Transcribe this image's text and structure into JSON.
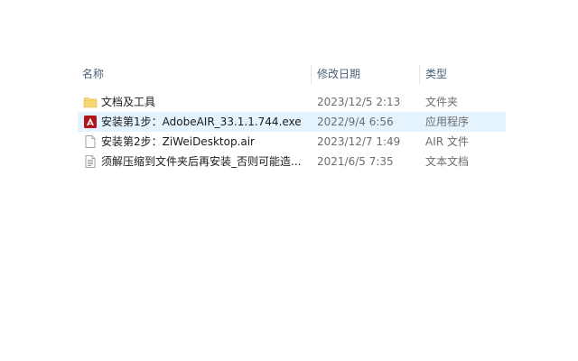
{
  "columns": {
    "name": "名称",
    "date": "修改日期",
    "type": "类型"
  },
  "files": [
    {
      "name": "文档及工具",
      "date": "2023/12/5 2:13",
      "type": "文件夹",
      "icon": "folder-icon",
      "selected": false
    },
    {
      "name": "安装第1步：AdobeAIR_33.1.1.744.exe",
      "date": "2022/9/4 6:56",
      "type": "应用程序",
      "icon": "adobe-air-app-icon",
      "selected": true
    },
    {
      "name": "安装第2步：ZiWeiDesktop.air",
      "date": "2023/12/7 1:49",
      "type": "AIR 文件",
      "icon": "blank-file-icon",
      "selected": false
    },
    {
      "name": "须解压缩到文件夹后再安装_否则可能造...",
      "date": "2021/6/5 7:35",
      "type": "文本文档",
      "icon": "text-document-icon",
      "selected": false
    }
  ],
  "colors": {
    "selected_row": "#e5f3ff",
    "header_text": "#4c607a",
    "folder": "#f8d775",
    "adobe_red": "#c41e1e"
  }
}
